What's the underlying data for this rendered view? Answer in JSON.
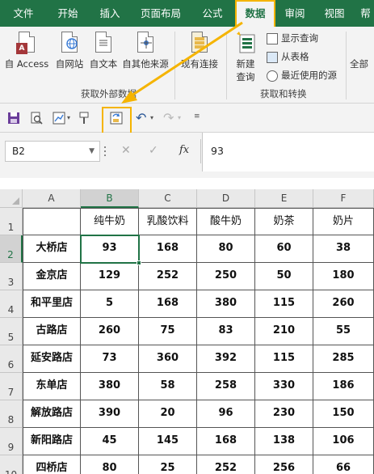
{
  "tabs": [
    {
      "id": "file",
      "label": "文件"
    },
    {
      "id": "home",
      "label": "开始"
    },
    {
      "id": "insert",
      "label": "插入"
    },
    {
      "id": "layout",
      "label": "页面布局"
    },
    {
      "id": "formulas",
      "label": "公式"
    },
    {
      "id": "data",
      "label": "数据"
    },
    {
      "id": "review",
      "label": "审阅"
    },
    {
      "id": "view",
      "label": "视图"
    },
    {
      "id": "help",
      "label": "帮"
    }
  ],
  "ribbon": {
    "get_external": {
      "access": "自 Access",
      "web": "自网站",
      "text": "自文本",
      "other": "自其他来源",
      "group_label": "获取外部数据"
    },
    "existing_connections": "现有连接",
    "new_query_line1": "新建",
    "new_query_line2": "查询",
    "show_queries": "显示查询",
    "from_table": "从表格",
    "recent_sources": "最近使用的源",
    "transform_group_label": "获取和转换",
    "refresh_all_partial": "全部"
  },
  "formula_bar": {
    "name_box": "B2",
    "content": "93",
    "fx": "fx"
  },
  "sheet": {
    "columns": [
      "A",
      "B",
      "C",
      "D",
      "E",
      "F"
    ],
    "rows": [
      "1",
      "2",
      "3",
      "4",
      "5",
      "6",
      "7",
      "8",
      "9",
      "10"
    ],
    "header_row": [
      "",
      "纯牛奶",
      "乳酸饮料",
      "酸牛奶",
      "奶茶",
      "奶片"
    ],
    "data": [
      [
        "大桥店",
        "93",
        "168",
        "80",
        "60",
        "38"
      ],
      [
        "金京店",
        "129",
        "252",
        "250",
        "50",
        "180"
      ],
      [
        "和平里店",
        "5",
        "168",
        "380",
        "115",
        "260"
      ],
      [
        "古路店",
        "260",
        "75",
        "83",
        "210",
        "55"
      ],
      [
        "延安路店",
        "73",
        "360",
        "392",
        "115",
        "285"
      ],
      [
        "东单店",
        "380",
        "58",
        "258",
        "330",
        "186"
      ],
      [
        "解放路店",
        "390",
        "20",
        "96",
        "230",
        "150"
      ],
      [
        "新阳路店",
        "45",
        "145",
        "168",
        "138",
        "106"
      ],
      [
        "四桥店",
        "80",
        "25",
        "252",
        "256",
        "66"
      ]
    ],
    "active_cell": "B2"
  },
  "colors": {
    "excel_green": "#217346",
    "highlight": "#f5b400"
  }
}
